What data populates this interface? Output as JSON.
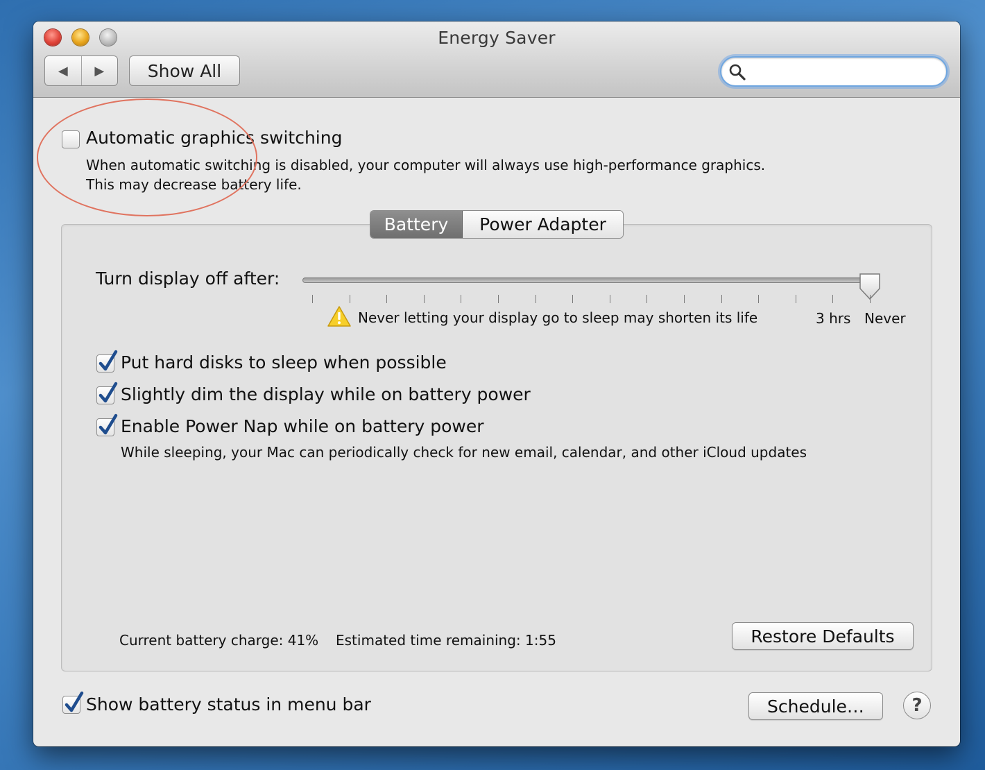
{
  "window": {
    "title": "Energy Saver"
  },
  "toolbar": {
    "back_glyph": "◀",
    "forward_glyph": "▶",
    "show_all_label": "Show All",
    "search_placeholder": "",
    "search_value": ""
  },
  "graphics": {
    "checkbox_label": "Automatic graphics switching",
    "checked": false,
    "description_line1": "When automatic switching is disabled, your computer will always use high-performance graphics.",
    "description_line2": "This may decrease battery life.",
    "annotation_color": "#e0735f"
  },
  "tabs": [
    {
      "label": "Battery",
      "selected": true
    },
    {
      "label": "Power Adapter",
      "selected": false
    }
  ],
  "display_sleep": {
    "label": "Turn display off after:",
    "value_fraction": 1.0,
    "selected_value": "Never",
    "tick_count": 16,
    "warning_icon": "warning-triangle-icon",
    "warning_text": "Never letting your display go to sleep may shorten its life",
    "tick_label_3hrs": "3 hrs",
    "tick_label_never": "Never"
  },
  "options": [
    {
      "label": "Put hard disks to sleep when possible",
      "checked": true
    },
    {
      "label": "Slightly dim the display while on battery power",
      "checked": true
    },
    {
      "label": "Enable Power Nap while on battery power",
      "checked": true,
      "description": "While sleeping, your Mac can periodically check for new email, calendar, and other iCloud updates"
    }
  ],
  "battery_status": {
    "charge_text": "Current battery charge: 41%",
    "charge_percent": 41,
    "time_text": "Estimated time remaining: 1:55"
  },
  "buttons": {
    "restore_defaults": "Restore Defaults",
    "schedule": "Schedule…",
    "help": "?"
  },
  "menu_bar_status": {
    "label": "Show battery status in menu bar",
    "checked": true
  }
}
